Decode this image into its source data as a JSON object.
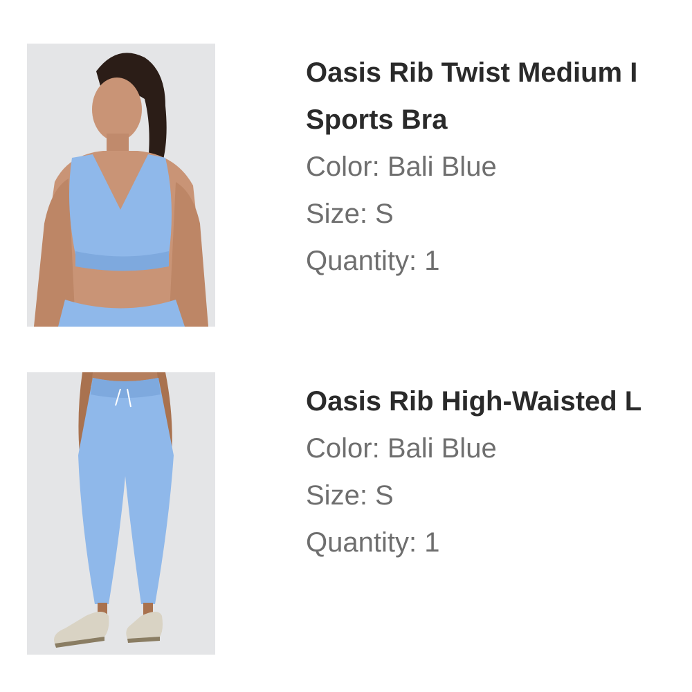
{
  "items": [
    {
      "title_lines": [
        "Oasis Rib Twist Medium I",
        "Sports Bra"
      ],
      "color": "Color: Bali Blue",
      "size": "Size: S",
      "quantity": "Quantity: 1",
      "image": "model-in-blue-sports-bra"
    },
    {
      "title_lines": [
        "Oasis Rib High-Waisted L"
      ],
      "color": "Color: Bali Blue",
      "size": "Size: S",
      "quantity": "Quantity: 1",
      "image": "model-in-blue-leggings"
    }
  ],
  "colors": {
    "garment": "#8fb8ea",
    "background": "#e6e7e9",
    "title": "#2a2a2a",
    "meta": "#6e6e6e"
  }
}
